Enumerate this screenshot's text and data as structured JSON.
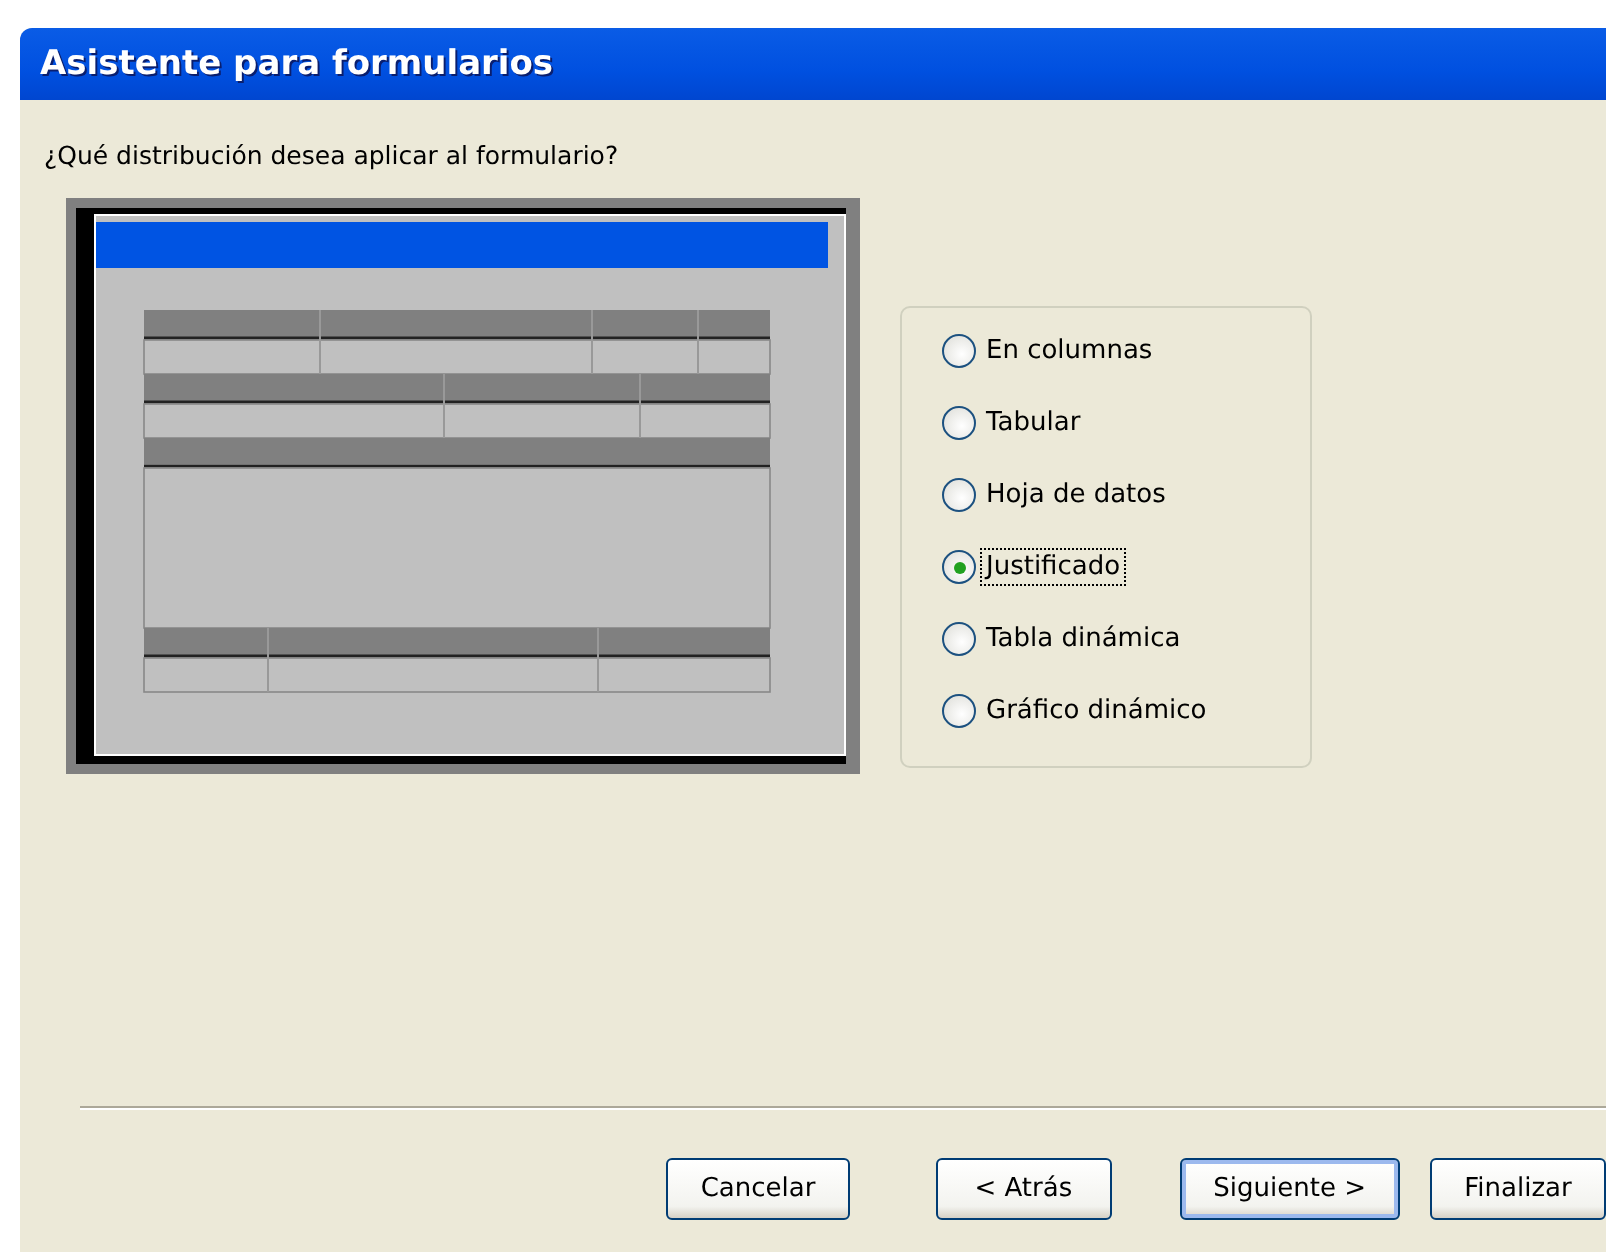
{
  "window": {
    "title": "Asistente para formularios"
  },
  "prompt": "¿Qué distribución desea aplicar al formulario?",
  "layout_options": [
    {
      "label": "En columnas",
      "selected": false
    },
    {
      "label": "Tabular",
      "selected": false
    },
    {
      "label": "Hoja de datos",
      "selected": false
    },
    {
      "label": "Justificado",
      "selected": true
    },
    {
      "label": "Tabla dinámica",
      "selected": false
    },
    {
      "label": "Gráfico dinámico",
      "selected": false
    }
  ],
  "buttons": [
    {
      "label": "Cancelar",
      "default": false
    },
    {
      "label": "< Atrás",
      "default": false
    },
    {
      "label": "Siguiente >",
      "default": true
    },
    {
      "label": "Finalizar",
      "default": false
    }
  ]
}
